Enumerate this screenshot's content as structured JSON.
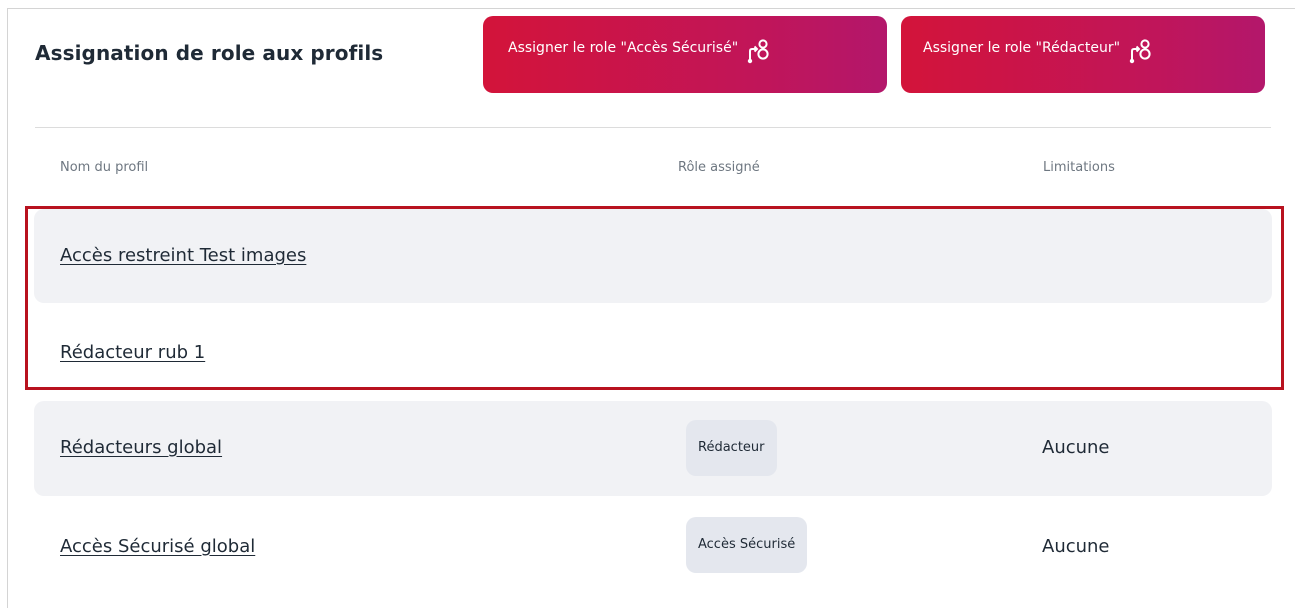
{
  "header": {
    "title": "Assignation de role aux profils"
  },
  "actions": {
    "assign_secure_label": "Assigner le role \"Accès Sécurisé\"",
    "assign_editor_label": "Assigner le role \"Rédacteur\"",
    "icon": "user-assign-icon"
  },
  "table": {
    "columns": [
      "Nom du profil",
      "Rôle assigné",
      "Limitations"
    ],
    "rows": [
      {
        "name": "Accès restreint Test images",
        "role": "",
        "limitations": ""
      },
      {
        "name": "Rédacteur rub 1",
        "role": "",
        "limitations": ""
      },
      {
        "name": "Rédacteurs global",
        "role": "Rédacteur",
        "limitations": "Aucune"
      },
      {
        "name": "Accès Sécurisé global",
        "role": "Accès Sécurisé",
        "limitations": "Aucune"
      }
    ]
  },
  "colors": {
    "button_gradient_start": "#d3143a",
    "button_gradient_end": "#b3176b",
    "highlight_border": "#b8121f",
    "row_shade": "#f1f2f5",
    "badge_bg": "#e4e7ee"
  }
}
